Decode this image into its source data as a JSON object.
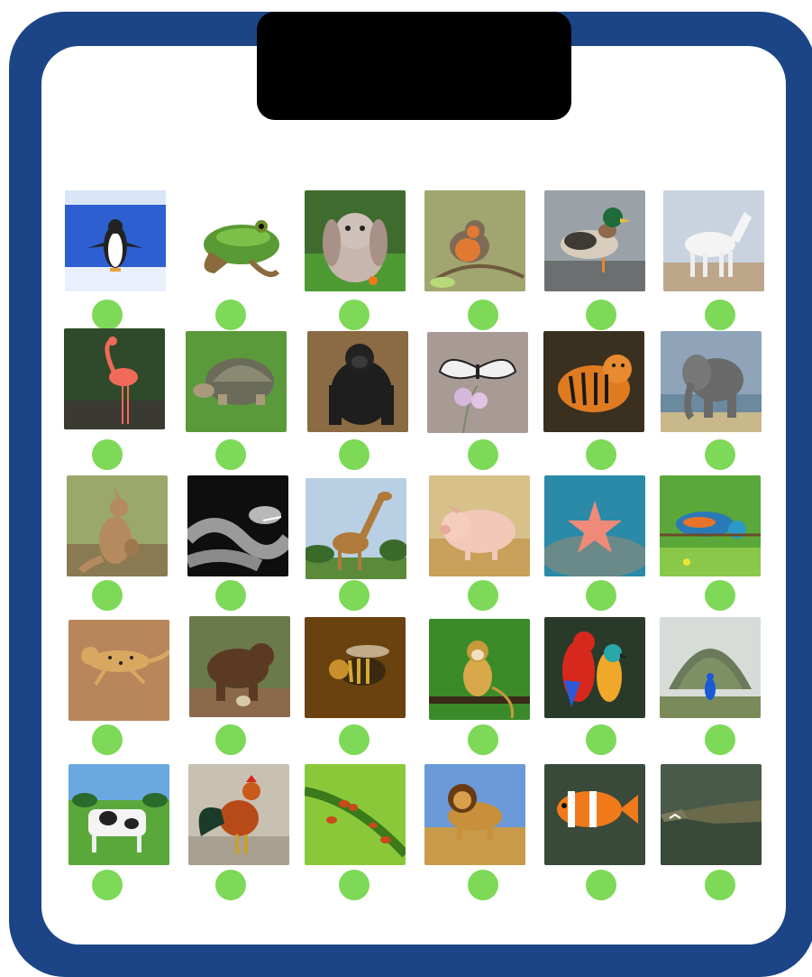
{
  "colors": {
    "frame": "#1c4587",
    "panel": "#ffffff",
    "clip": "#000000",
    "button": "#7dd957"
  },
  "animals": [
    "penguin",
    "frog",
    "rabbit",
    "robin",
    "duck",
    "horse",
    "flamingo",
    "tortoise",
    "gorilla",
    "butterfly",
    "tiger",
    "elephant",
    "kangaroo",
    "snake",
    "giraffe",
    "pig",
    "starfish",
    "chameleon",
    "cheetah",
    "bear",
    "bee",
    "monkey",
    "parrot",
    "peacock",
    "cow",
    "rooster",
    "ant",
    "lion",
    "clownfish",
    "crocodile"
  ]
}
